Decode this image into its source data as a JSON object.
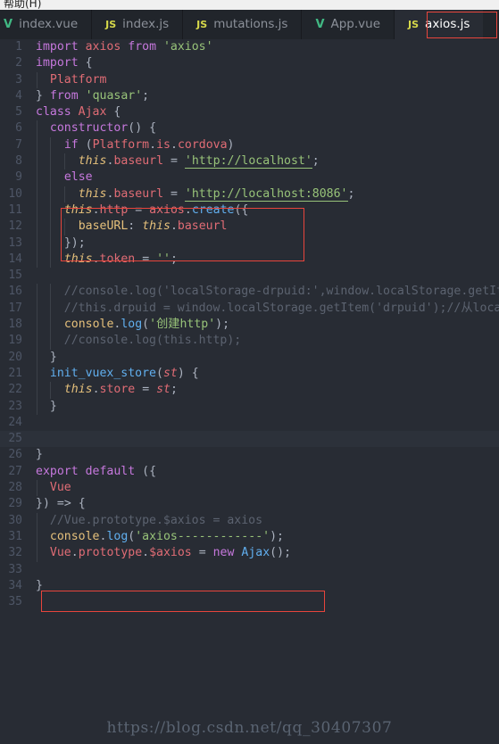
{
  "menubar": {
    "help_label": "帮助(H)"
  },
  "tabs": [
    {
      "label": "index.vue",
      "icon": "vue-file-icon",
      "icon_glyph": "V",
      "active": false
    },
    {
      "label": "index.js",
      "icon": "js-file-icon",
      "icon_glyph": "JS",
      "active": false
    },
    {
      "label": "mutations.js",
      "icon": "js-file-icon",
      "icon_glyph": "JS",
      "active": false
    },
    {
      "label": "App.vue",
      "icon": "vue-file-icon",
      "icon_glyph": "V",
      "active": false
    },
    {
      "label": "axios.js",
      "icon": "js-file-icon",
      "icon_glyph": "JS",
      "active": true
    }
  ],
  "editor": {
    "language": "javascript",
    "current_line": 25,
    "total_lines": 35,
    "line_numbers": [
      1,
      2,
      3,
      4,
      5,
      6,
      7,
      8,
      9,
      10,
      11,
      12,
      13,
      14,
      15,
      16,
      17,
      18,
      19,
      20,
      21,
      22,
      23,
      24,
      25,
      26,
      27,
      28,
      29,
      30,
      31,
      32,
      33,
      34,
      35
    ],
    "lines": [
      "import axios from 'axios'",
      "import {",
      "  Platform",
      "} from 'quasar';",
      "class Ajax {",
      "  constructor() {",
      "    if (Platform.is.cordova)",
      "      this.baseurl = 'http://localhost';",
      "    else",
      "      this.baseurl = 'http://localhost:8086';",
      "    this.http = axios.create({",
      "      baseURL: this.baseurl",
      "    });",
      "    this.token = '';",
      "",
      "    //console.log('localStorage-drpuid:',window.localStorage.getItem",
      "    //this.drpuid = window.localStorage.getItem('drpuid');//从localS",
      "    console.log('创建http');",
      "    //console.log(this.http);",
      "  }",
      "  init_vuex_store(st) {",
      "    this.store = st;",
      "  }",
      "",
      "",
      "}",
      "export default ({",
      "  Vue",
      "}) => {",
      "  //Vue.prototype.$axios = axios",
      "  console.log('axios------------');",
      "  Vue.prototype.$axios = new Ajax();",
      "",
      "}",
      ""
    ]
  },
  "annotations": [
    {
      "name": "axios-create-block",
      "color": "#e8453c",
      "covers_lines": [
        11,
        12,
        13
      ]
    },
    {
      "name": "vue-prototype-line",
      "color": "#e8453c",
      "covers_lines": [
        32
      ]
    },
    {
      "name": "active-tab-box",
      "color": "#e8453c",
      "covers": "axios.js tab"
    }
  ],
  "watermark": {
    "text": "https://blog.csdn.net/qq_30407307"
  },
  "theme": {
    "background": "#282c34",
    "tabbar_background": "#21252b",
    "current_line": "#2c313a",
    "line_number": "#4e5666",
    "keyword": "#c678dd",
    "string": "#98c379",
    "function": "#61afef",
    "variable": "#e06c75",
    "this_keyword": "#e5c07b",
    "comment": "#5c6370",
    "punctuation": "#abb2bf",
    "accent_red": "#e8453c"
  }
}
